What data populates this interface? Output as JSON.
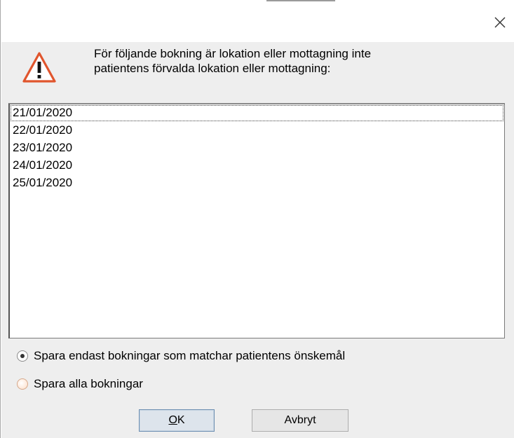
{
  "dialog": {
    "message_line1": "För följande bokning är lokation eller mottagning inte",
    "message_line2": "patientens förvalda lokation eller mottagning:",
    "icon": "warning-triangle-icon",
    "accent_color": "#e0552d"
  },
  "list": {
    "items": [
      "21/01/2020",
      "22/01/2020",
      "23/01/2020",
      "24/01/2020",
      "25/01/2020"
    ],
    "focused_index": 0
  },
  "options": {
    "radio1_label": "Spara endast bokningar som matchar patientens önskemål",
    "radio1_checked": true,
    "radio2_label": "Spara alla bokningar",
    "radio2_checked": false
  },
  "buttons": {
    "ok_mnemonic": "O",
    "ok_rest": "K",
    "cancel_label": "Avbryt"
  }
}
